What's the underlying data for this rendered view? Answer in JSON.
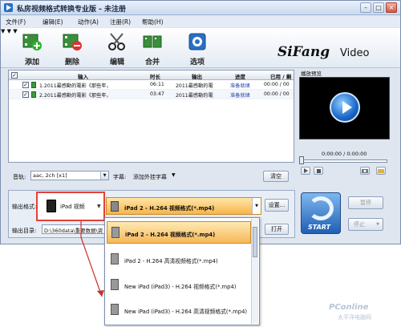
{
  "window": {
    "title": "私房视频格式转换专业版 - 未注册"
  },
  "menu": {
    "items": [
      "文件(F)",
      "编辑(E)",
      "动作(A)",
      "注册(R)",
      "帮助(H)"
    ]
  },
  "toolbar": {
    "add": "添加",
    "delete": "删除",
    "edit": "编辑",
    "merge": "合并",
    "options": "选项"
  },
  "logo": {
    "brand": "SiFang",
    "sub": "Video"
  },
  "file_list": {
    "columns": [
      "输入",
      "时长",
      "输出",
      "进度",
      "已用 / 剩余"
    ],
    "rows": [
      {
        "input": "1.2011最感動的電影《那些年，",
        "duration": "06:11",
        "output": "2011最感動的電",
        "progress": "准备就绪",
        "time": "00:00 / 00"
      },
      {
        "input": "2.2011最感動的電影《那些年，",
        "duration": "03:47",
        "output": "2011最感動的電",
        "progress": "准备就绪",
        "time": "00:00 / 00"
      }
    ]
  },
  "preview": {
    "label": "播放预览",
    "time": "0:00:00 / 0:00:00"
  },
  "audio": {
    "label": "音轨:",
    "value": "aac, 2ch [x1]",
    "subtitle_label": "字幕:",
    "subtitle_value": "添加外挂字幕",
    "clear": "清空"
  },
  "format": {
    "label": "输出格式:",
    "device": "iPad 视频",
    "selected": "iPad 2 - H.264 视频格式(*.mp4)",
    "settings": "设置...",
    "dir_label": "输出目录:",
    "dir_value": "D:\\360data\\重要数据\\资",
    "open": "打开"
  },
  "dropdown": {
    "items": [
      "iPad 2 - H.264 视频格式(*.mp4)",
      "iPad 2 - H.264 高清视频格式(*.mp4)",
      "New iPad (iPad3) - H.264 视频格式(*.mp4)",
      "New iPad (iPad3) - H.264 高清视频格式(*.mp4)"
    ]
  },
  "actions": {
    "start": "START",
    "pause": "暂停",
    "stop": "停止"
  },
  "watermark": {
    "brand": "PConline",
    "sub": "太平洋电脑网"
  }
}
